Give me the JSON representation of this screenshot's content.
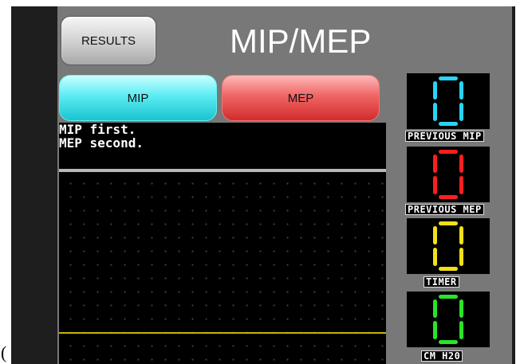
{
  "stray_char": "(",
  "header": {
    "results_label": "RESULTS",
    "title": "MIP/MEP"
  },
  "modes": {
    "mip_label": "MIP",
    "mep_label": "MEP"
  },
  "message": {
    "line1": "MIP first.",
    "line2": "MEP second."
  },
  "displays": [
    {
      "label": "PREVIOUS MIP",
      "color": "#29d3f5",
      "digit": "0"
    },
    {
      "label": "PREVIOUS MEP",
      "color": "#ff1e1e",
      "digit": "0"
    },
    {
      "label": "TIMER",
      "color": "#f2e01a",
      "digit": "0"
    },
    {
      "label": "CM H20",
      "color": "#2be32b",
      "digit": "0"
    }
  ],
  "colors": {
    "mip_button": "#3ee0ea",
    "mep_button": "#e84848",
    "baseline": "#c8b400",
    "screen_bg": "#787878"
  }
}
